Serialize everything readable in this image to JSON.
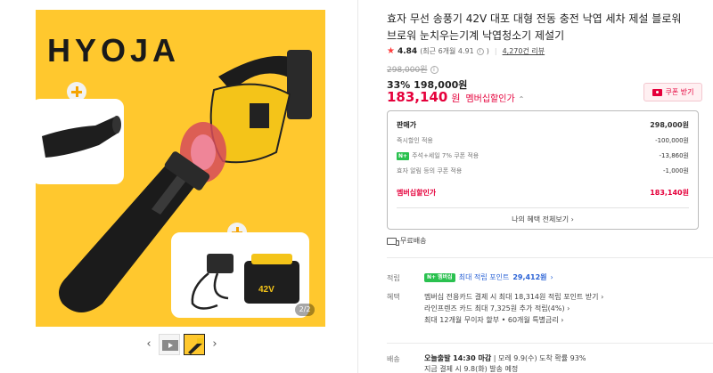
{
  "gallery": {
    "brand": "HYOJA",
    "battery_label": "42V",
    "counter": "2/2",
    "prev": "‹",
    "next": "›"
  },
  "product": {
    "title": "효자 무선 송풍기 42V 대포 대형 전동 충전 낙엽 세차 제설 블로워 브로워 눈치우는기계 낙엽청소기 제설기",
    "rating": "4.84",
    "rating_detail": "(최근 6개월 4.91",
    "rating_detail_close": ")",
    "reviews": "4,270건 리뷰",
    "original_price": "298,000원",
    "discount": "33% 198,000원",
    "final_price": "183,140",
    "final_unit": "원",
    "member_label": "멤버십할인가",
    "coupon_button": "쿠폰 받기"
  },
  "price_box": {
    "rows": [
      {
        "label": "판매가",
        "value": "298,000원"
      },
      {
        "label": "즉시할인 적용",
        "value": "-100,000원"
      },
      {
        "badge": "N+",
        "label": "주석+세일 7% 쿠폰 적용",
        "value": "-13,860원"
      },
      {
        "label": "효자 알림 등의 쿠폰 적용",
        "value": "-1,000원"
      },
      {
        "label": "멤버십할인가",
        "value": "183,140원"
      }
    ],
    "more": "나의 혜택 전체보기 ›"
  },
  "shipping": {
    "label": "무료배송"
  },
  "points": {
    "label": "적립",
    "badge": "N+ 멤버십",
    "text": "최대 적립 포인트",
    "amount": "29,412원",
    "chevron": "›"
  },
  "benefits": {
    "label": "혜택",
    "lines": [
      "멤버십 전용카드 결제 시 최대 18,314원 적립 포인트 받기 ›",
      "라인프렌즈 카드 최대 7,325원 추가 적립(4%) ›",
      "최대 12개월 무이자 할부 • 60개월 특별금리 ›"
    ]
  },
  "delivery": {
    "label": "배송",
    "line1_bold": "오늘출발 14:30 마감",
    "line1_rest": " | 모레 9.9(수) 도착 확률 93%",
    "line2": "지금 결제 시 9.8(화) 발송 예정"
  }
}
